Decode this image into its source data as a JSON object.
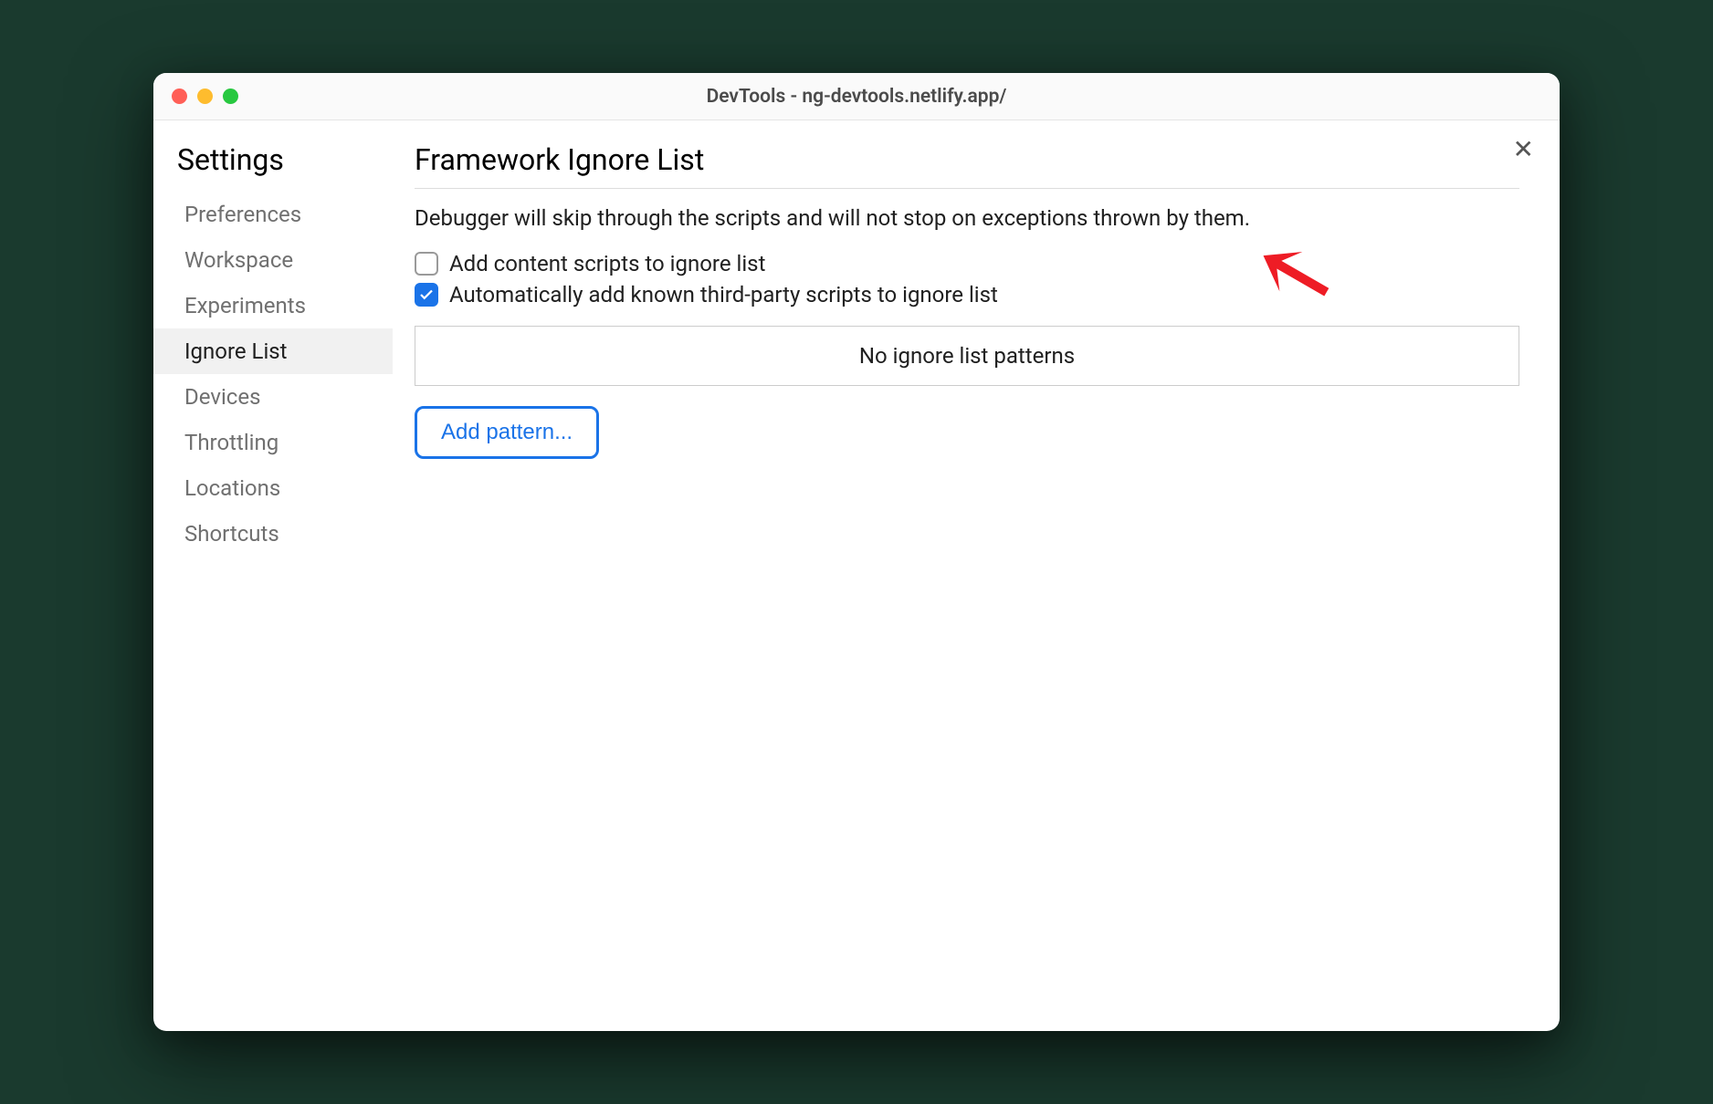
{
  "window": {
    "title": "DevTools - ng-devtools.netlify.app/"
  },
  "sidebar": {
    "title": "Settings",
    "items": [
      {
        "label": "Preferences",
        "active": false
      },
      {
        "label": "Workspace",
        "active": false
      },
      {
        "label": "Experiments",
        "active": false
      },
      {
        "label": "Ignore List",
        "active": true
      },
      {
        "label": "Devices",
        "active": false
      },
      {
        "label": "Throttling",
        "active": false
      },
      {
        "label": "Locations",
        "active": false
      },
      {
        "label": "Shortcuts",
        "active": false
      }
    ]
  },
  "main": {
    "title": "Framework Ignore List",
    "description": "Debugger will skip through the scripts and will not stop on exceptions thrown by them.",
    "checkboxes": [
      {
        "label": "Add content scripts to ignore list",
        "checked": false
      },
      {
        "label": "Automatically add known third-party scripts to ignore list",
        "checked": true
      }
    ],
    "patterns_empty": "No ignore list patterns",
    "add_pattern_label": "Add pattern..."
  }
}
